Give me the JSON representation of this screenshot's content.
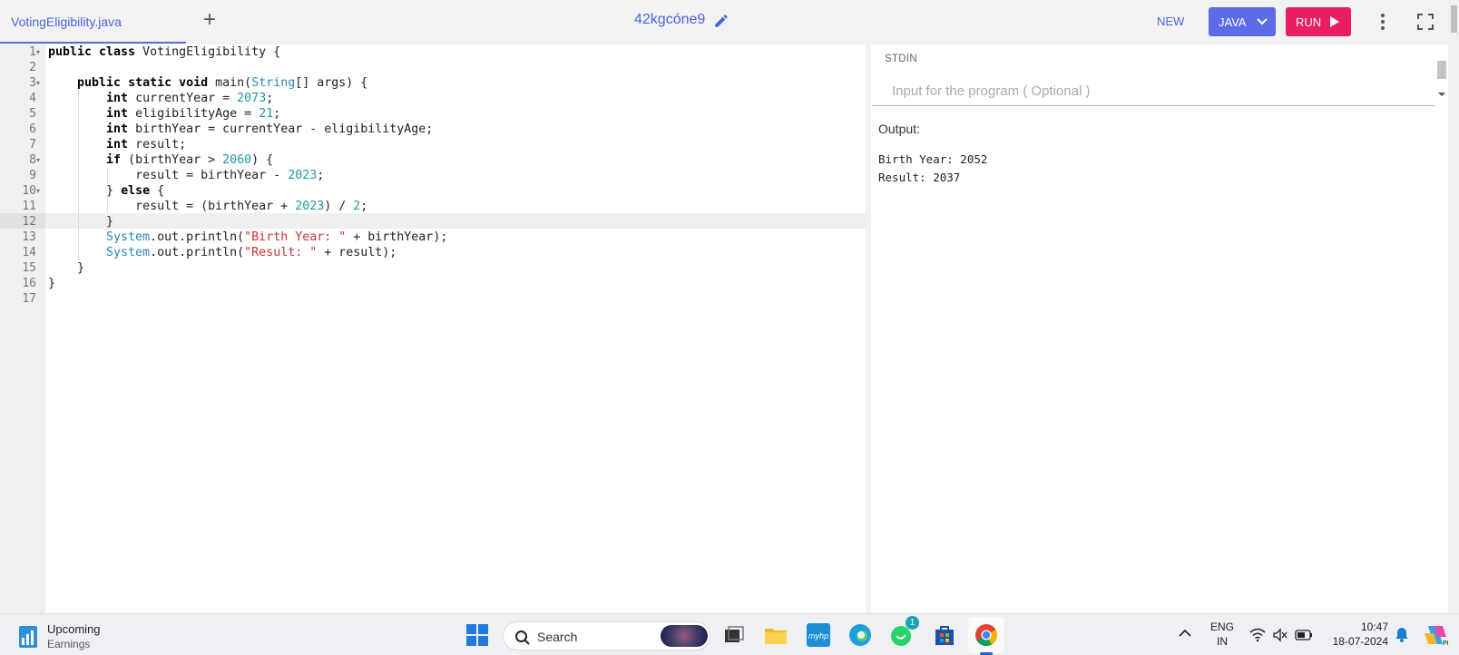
{
  "tab": {
    "filename": "VotingEligibility.java"
  },
  "header": {
    "project_name": "42kgcóne9"
  },
  "toolbar": {
    "new_label": "NEW",
    "language_label": "JAVA",
    "run_label": "RUN"
  },
  "editor": {
    "line_numbers": [
      "1",
      "2",
      "3",
      "4",
      "5",
      "6",
      "7",
      "8",
      "9",
      "10",
      "11",
      "12",
      "13",
      "14",
      "15",
      "16",
      "17"
    ],
    "folded_lines": [
      1,
      3,
      8,
      10
    ],
    "active_line": 12
  },
  "stdin": {
    "label": "STDIN",
    "placeholder": "Input for the program ( Optional )"
  },
  "output": {
    "label": "Output:",
    "text": "Birth Year: 2052\nResult: 2037"
  },
  "taskbar": {
    "widget_title": "Upcoming",
    "widget_subtitle": "Earnings",
    "search_label": "Search",
    "whatsapp_badge": "1",
    "lang_line1": "ENG",
    "lang_line2": "IN",
    "time": "10:47",
    "date": "18-07-2024"
  },
  "colors": {
    "accent": "#5b6bea",
    "run": "#e91e63",
    "link": "#4a64e0"
  }
}
